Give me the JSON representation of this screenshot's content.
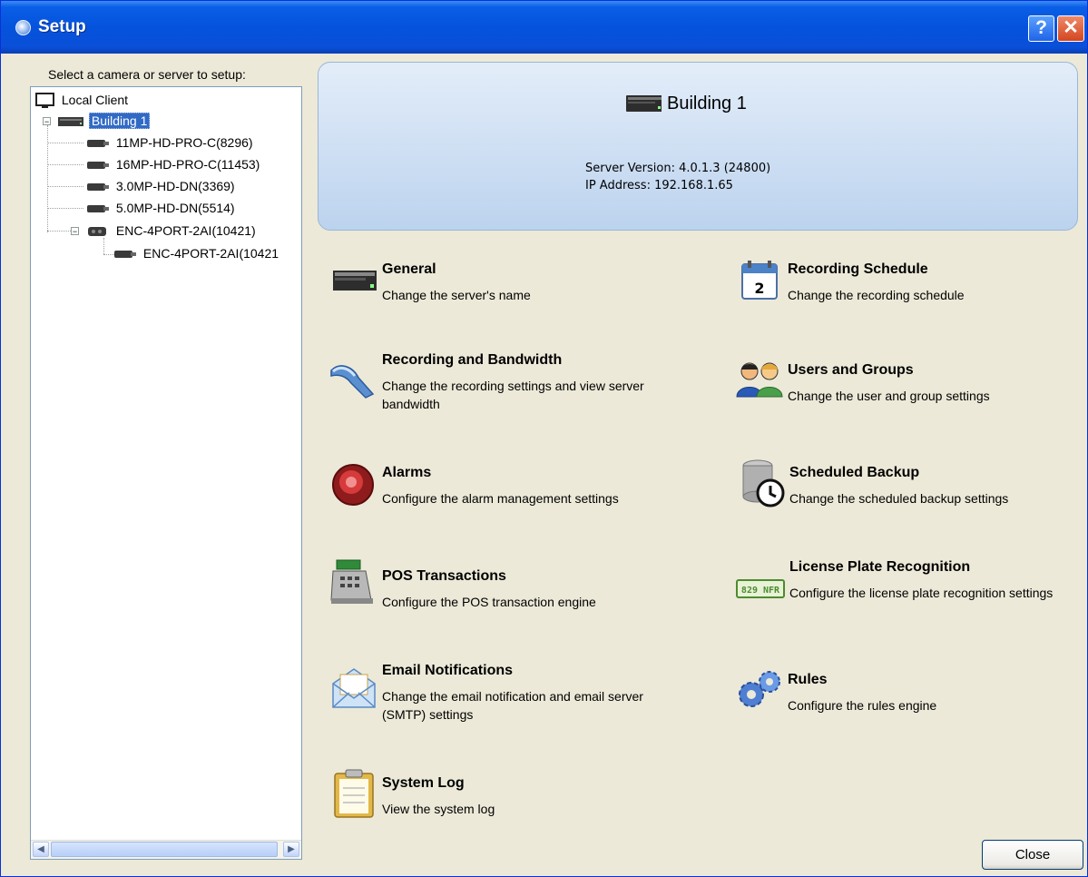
{
  "window": {
    "title": "Setup",
    "help_label": "?",
    "close_label": "✕"
  },
  "tree": {
    "label": "Select a camera or server to setup:",
    "nodes": [
      {
        "label": "Local Client"
      },
      {
        "label": "Building 1"
      },
      {
        "label": "11MP-HD-PRO-C(8296)"
      },
      {
        "label": "16MP-HD-PRO-C(11453)"
      },
      {
        "label": "3.0MP-HD-DN(3369)"
      },
      {
        "label": "5.0MP-HD-DN(5514)"
      },
      {
        "label": "ENC-4PORT-2AI(10421)"
      },
      {
        "label": "ENC-4PORT-2AI(10421"
      }
    ]
  },
  "server": {
    "name": "Building 1",
    "version": "Server Version: 4.0.1.3 (24800)",
    "ip": "IP Address: 192.168.1.65"
  },
  "options": {
    "general": {
      "title": "General",
      "desc": "Change the server's name"
    },
    "recording_schedule": {
      "title": "Recording Schedule",
      "desc": "Change the recording schedule",
      "icon_text": "2"
    },
    "recording_bandwidth": {
      "title": "Recording and Bandwidth",
      "desc": "Change the recording settings and view server bandwidth"
    },
    "users_groups": {
      "title": "Users and Groups",
      "desc": "Change the user and group settings"
    },
    "alarms": {
      "title": "Alarms",
      "desc": "Configure the alarm management settings"
    },
    "scheduled_backup": {
      "title": "Scheduled Backup",
      "desc": "Change the scheduled backup settings"
    },
    "pos": {
      "title": "POS Transactions",
      "desc": "Configure the POS transaction engine"
    },
    "lpr": {
      "title": "License Plate Recognition",
      "desc": "Configure the license plate recognition settings",
      "icon_text": "829 NFR"
    },
    "email": {
      "title": "Email Notifications",
      "desc": "Change the email notification and email server (SMTP) settings"
    },
    "rules": {
      "title": "Rules",
      "desc": "Configure the rules engine"
    },
    "system_log": {
      "title": "System Log",
      "desc": "View the system log"
    }
  },
  "buttons": {
    "close": "Close"
  }
}
